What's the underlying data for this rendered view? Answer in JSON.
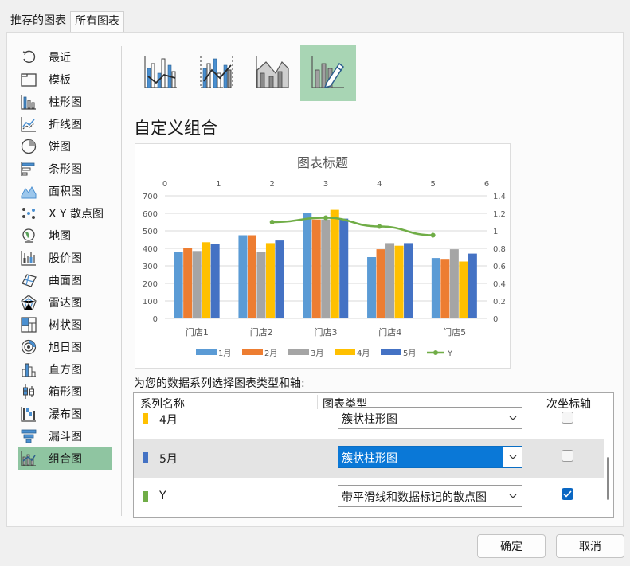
{
  "tabs": [
    {
      "label": "推荐的图表"
    },
    {
      "label": "所有图表"
    }
  ],
  "sidebar": {
    "items": [
      {
        "label": "最近",
        "icon": "recent-icon"
      },
      {
        "label": "模板",
        "icon": "template-icon"
      },
      {
        "label": "柱形图",
        "icon": "column-chart-icon"
      },
      {
        "label": "折线图",
        "icon": "line-chart-icon"
      },
      {
        "label": "饼图",
        "icon": "pie-chart-icon"
      },
      {
        "label": "条形图",
        "icon": "bar-chart-icon"
      },
      {
        "label": "面积图",
        "icon": "area-chart-icon"
      },
      {
        "label": "X Y 散点图",
        "icon": "scatter-chart-icon"
      },
      {
        "label": "地图",
        "icon": "map-chart-icon"
      },
      {
        "label": "股价图",
        "icon": "stock-chart-icon"
      },
      {
        "label": "曲面图",
        "icon": "surface-chart-icon"
      },
      {
        "label": "雷达图",
        "icon": "radar-chart-icon"
      },
      {
        "label": "树状图",
        "icon": "treemap-chart-icon"
      },
      {
        "label": "旭日图",
        "icon": "sunburst-chart-icon"
      },
      {
        "label": "直方图",
        "icon": "histogram-chart-icon"
      },
      {
        "label": "箱形图",
        "icon": "box-whisker-chart-icon"
      },
      {
        "label": "瀑布图",
        "icon": "waterfall-chart-icon"
      },
      {
        "label": "漏斗图",
        "icon": "funnel-chart-icon"
      },
      {
        "label": "组合图",
        "icon": "combo-chart-icon"
      }
    ],
    "selected_index": 18
  },
  "combo_types": [
    {
      "icon": "clustered-column-line-icon"
    },
    {
      "icon": "clustered-column-line-secondary-axis-icon"
    },
    {
      "icon": "stacked-area-clustered-column-icon"
    },
    {
      "icon": "custom-combination-icon"
    }
  ],
  "section_title": "自定义组合",
  "assign_label": "为您的数据系列选择图表类型和轴:",
  "table": {
    "headers": {
      "series_name": "系列名称",
      "chart_type": "图表类型",
      "secondary_axis": "次坐标轴"
    },
    "rows": [
      {
        "name": "4月",
        "color": "#ffc000",
        "chart_type": "簇状柱形图",
        "secondary": false
      },
      {
        "name": "5月",
        "color": "#4472c4",
        "chart_type": "簇状柱形图",
        "secondary": false
      },
      {
        "name": "Y",
        "color": "#70ad47",
        "chart_type": "带平滑线和数据标记的散点图",
        "secondary": true
      }
    ]
  },
  "buttons": {
    "ok": "确定",
    "cancel": "取消"
  },
  "colors": {
    "accent_green": "#8fc5a1",
    "select_blue": "#0a78d7"
  },
  "chart_data": {
    "type": "bar",
    "title": "图表标题",
    "categories": [
      "门店1",
      "门店2",
      "门店3",
      "门店4",
      "门店5"
    ],
    "series": [
      {
        "name": "1月",
        "color": "#5b9bd5",
        "values": [
          380,
          475,
          600,
          350,
          345
        ]
      },
      {
        "name": "2月",
        "color": "#ed7d31",
        "values": [
          400,
          475,
          565,
          395,
          340
        ]
      },
      {
        "name": "3月",
        "color": "#a5a5a5",
        "values": [
          385,
          380,
          565,
          430,
          395
        ]
      },
      {
        "name": "4月",
        "color": "#ffc000",
        "values": [
          435,
          430,
          620,
          415,
          325
        ]
      },
      {
        "name": "5月",
        "color": "#4472c4",
        "values": [
          425,
          445,
          570,
          430,
          370
        ]
      }
    ],
    "line_series": {
      "name": "Y",
      "color": "#70ad47",
      "x": [
        2,
        3,
        4,
        5
      ],
      "y": [
        1.1,
        1.15,
        1.05,
        0.95
      ]
    },
    "ylim": [
      0,
      700
    ],
    "yticks": [
      "0",
      "100",
      "200",
      "300",
      "400",
      "500",
      "600",
      "700"
    ],
    "y2lim": [
      0,
      1.4
    ],
    "y2ticks": [
      "0",
      "0.2",
      "0.4",
      "0.6",
      "0.8",
      "1",
      "1.2",
      "1.4"
    ],
    "x2lim": [
      0,
      6
    ],
    "x2ticks": [
      "0",
      "1",
      "2",
      "3",
      "4",
      "5",
      "6"
    ],
    "legend_position": "bottom",
    "grid": true
  }
}
